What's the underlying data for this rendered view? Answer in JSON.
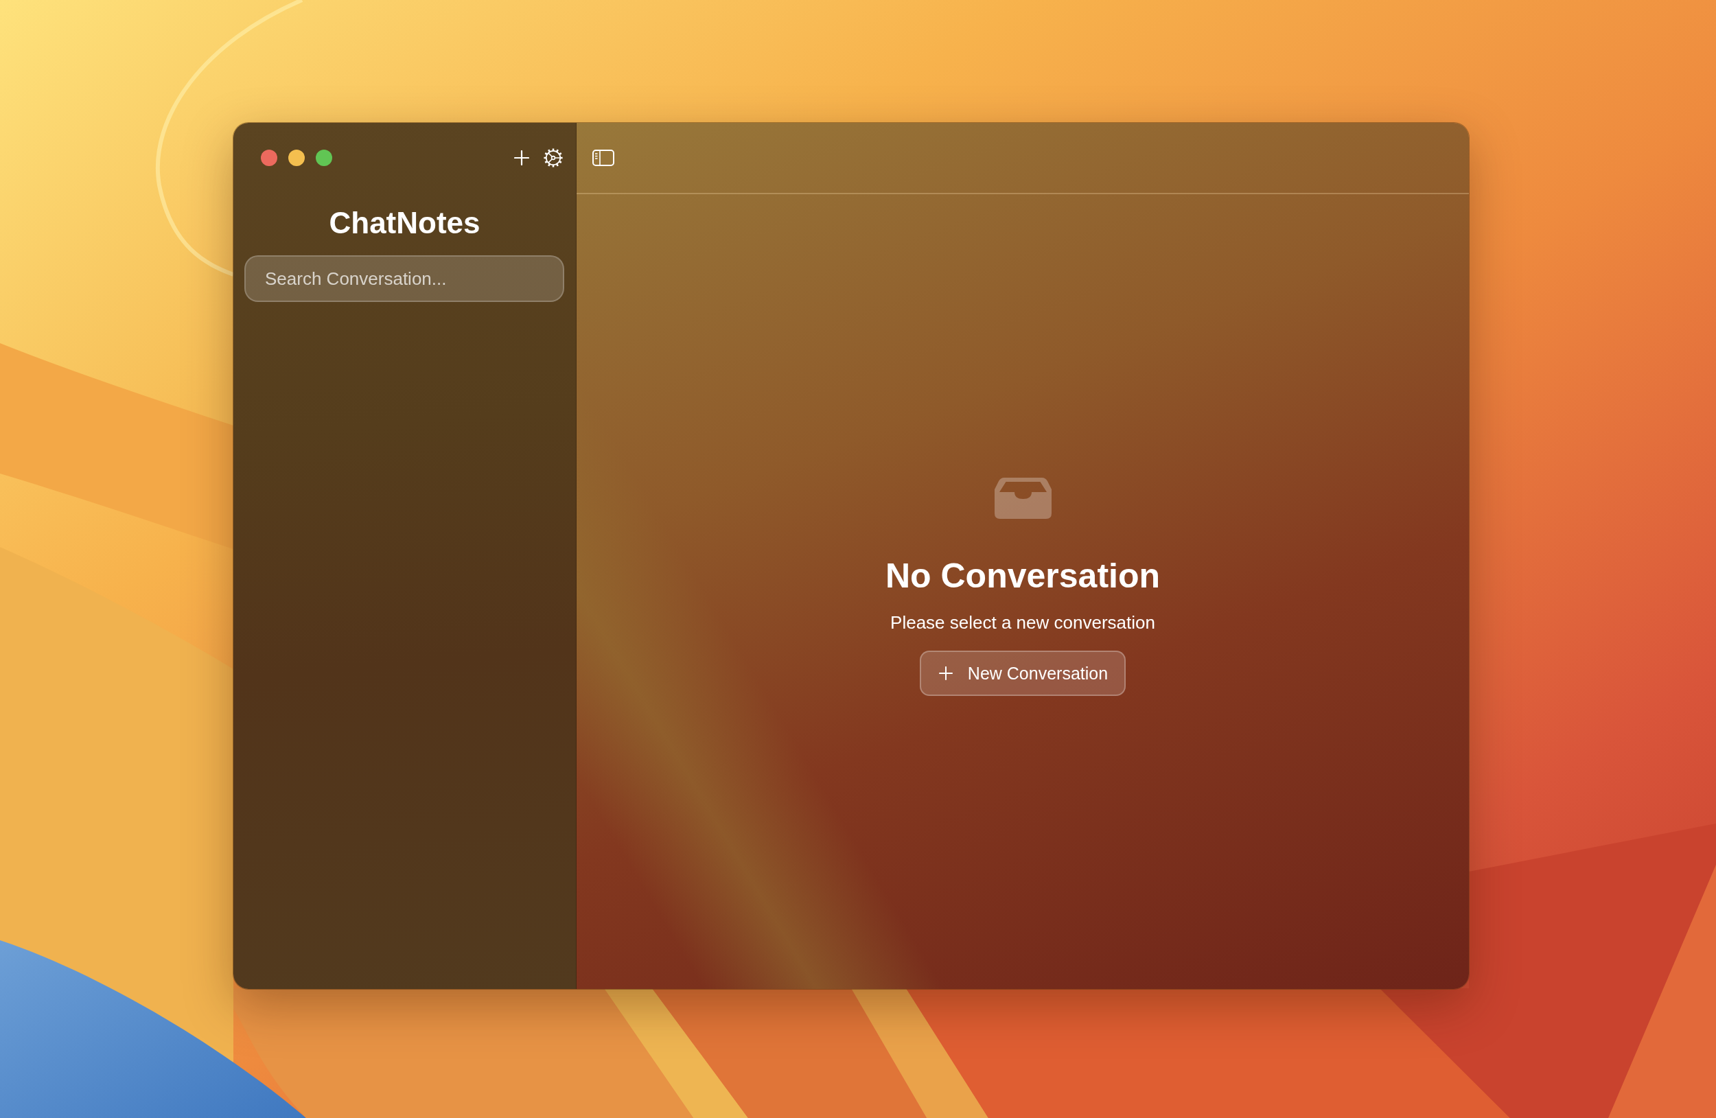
{
  "window": {
    "controls": [
      {
        "kind": "close"
      },
      {
        "kind": "minimize"
      },
      {
        "kind": "zoom"
      }
    ]
  },
  "sidebar": {
    "title": "ChatNotes",
    "search": {
      "placeholder": "Search Conversation..."
    }
  },
  "main": {
    "empty_state": {
      "title": "No Conversation",
      "message": "Please select a new conversation",
      "button": "New Conversation"
    }
  }
}
